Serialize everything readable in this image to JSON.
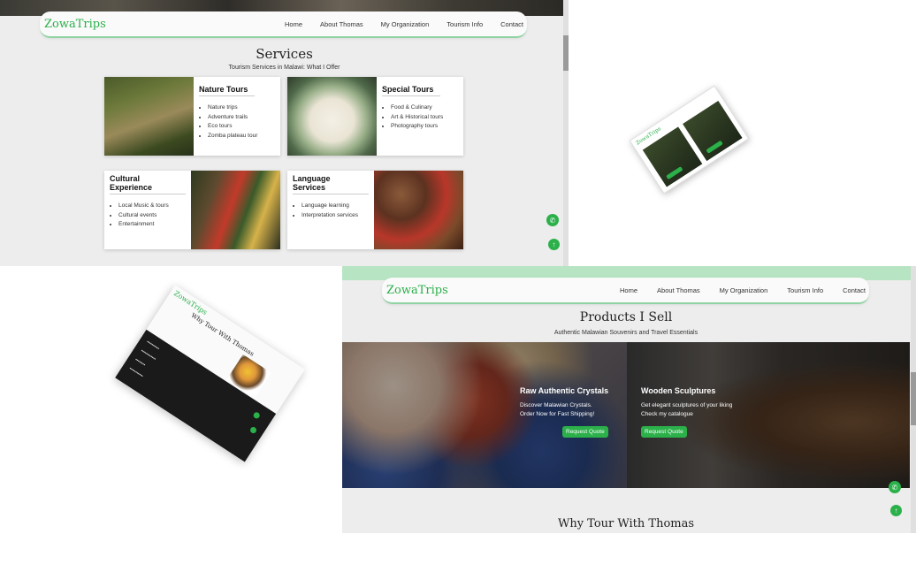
{
  "panel_services": {
    "logo": "ZowaTrips",
    "nav": [
      "Home",
      "About Thomas",
      "My Organization",
      "Tourism Info",
      "Contact"
    ],
    "title": "Services",
    "subtitle": "Tourism Services in Malawi: What I Offer",
    "cards": [
      {
        "title": "Nature Tours",
        "items": [
          "Nature trips",
          "Adventure trails",
          "Eco tours",
          "Zomba plateau tour"
        ]
      },
      {
        "title": "Special Tours",
        "items": [
          "Food & Culinary",
          "Art & Historical tours",
          "Photography tours"
        ]
      },
      {
        "title": "Cultural Experience",
        "items": [
          "Local Music & tours",
          "Cultural events",
          "Entertainment"
        ]
      },
      {
        "title": "Language Services",
        "items": [
          "Language learning",
          "Interpretation services"
        ]
      }
    ],
    "whatsapp_icon": "whatsapp-icon",
    "up_icon": "arrow-up-icon"
  },
  "panel_mobile_small": {
    "logo": "ZowaTrips"
  },
  "panel_mobile_why": {
    "logo": "ZowaTrips",
    "title": "Why Tour With Thomas"
  },
  "panel_products": {
    "logo": "ZowaTrips",
    "nav": [
      "Home",
      "About Thomas",
      "My Organization",
      "Tourism Info",
      "Contact"
    ],
    "title": "Products I Sell",
    "subtitle": "Authentic Malawian Souvenirs and Travel Essentials",
    "products": [
      {
        "title": "Raw Authentic Crystals",
        "line1": "Discover Malawian Crystals.",
        "line2": "Order Now for Fast Shipping!",
        "button": "Request Quote"
      },
      {
        "title": "Wooden Sculptures",
        "line1": "Get elegant sculptures of your liking",
        "line2": "Check my catalogue",
        "button": "Request Quote"
      }
    ],
    "why_title": "Why Tour With Thomas"
  },
  "colors": {
    "accent": "#2bb04a",
    "nav_border": "#8fd3a3",
    "page_bg": "#ededed"
  }
}
